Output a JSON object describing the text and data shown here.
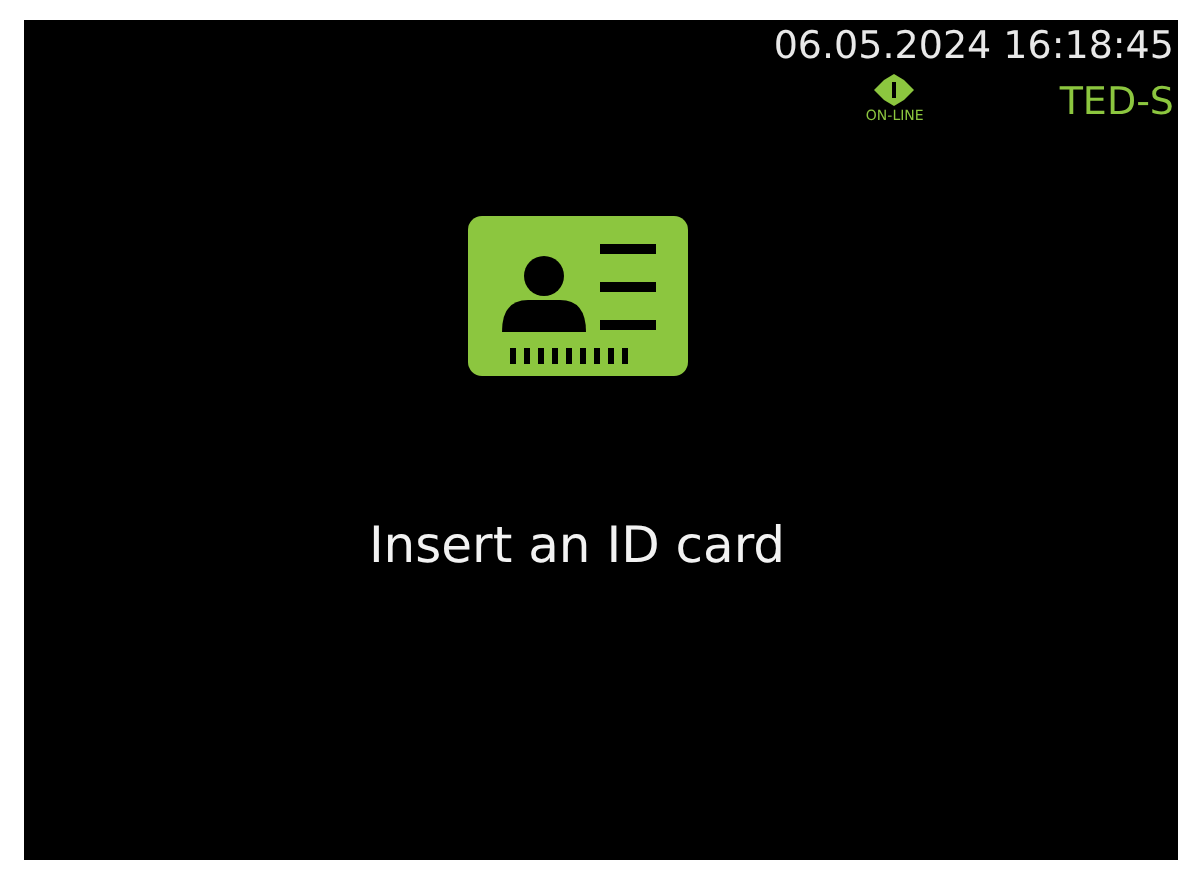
{
  "status": {
    "datetime": "06.05.2024 16:18:45",
    "connection_label": "ON-LINE",
    "online": true,
    "device": "TED-S"
  },
  "prompt": {
    "message": "Insert an ID card"
  }
}
